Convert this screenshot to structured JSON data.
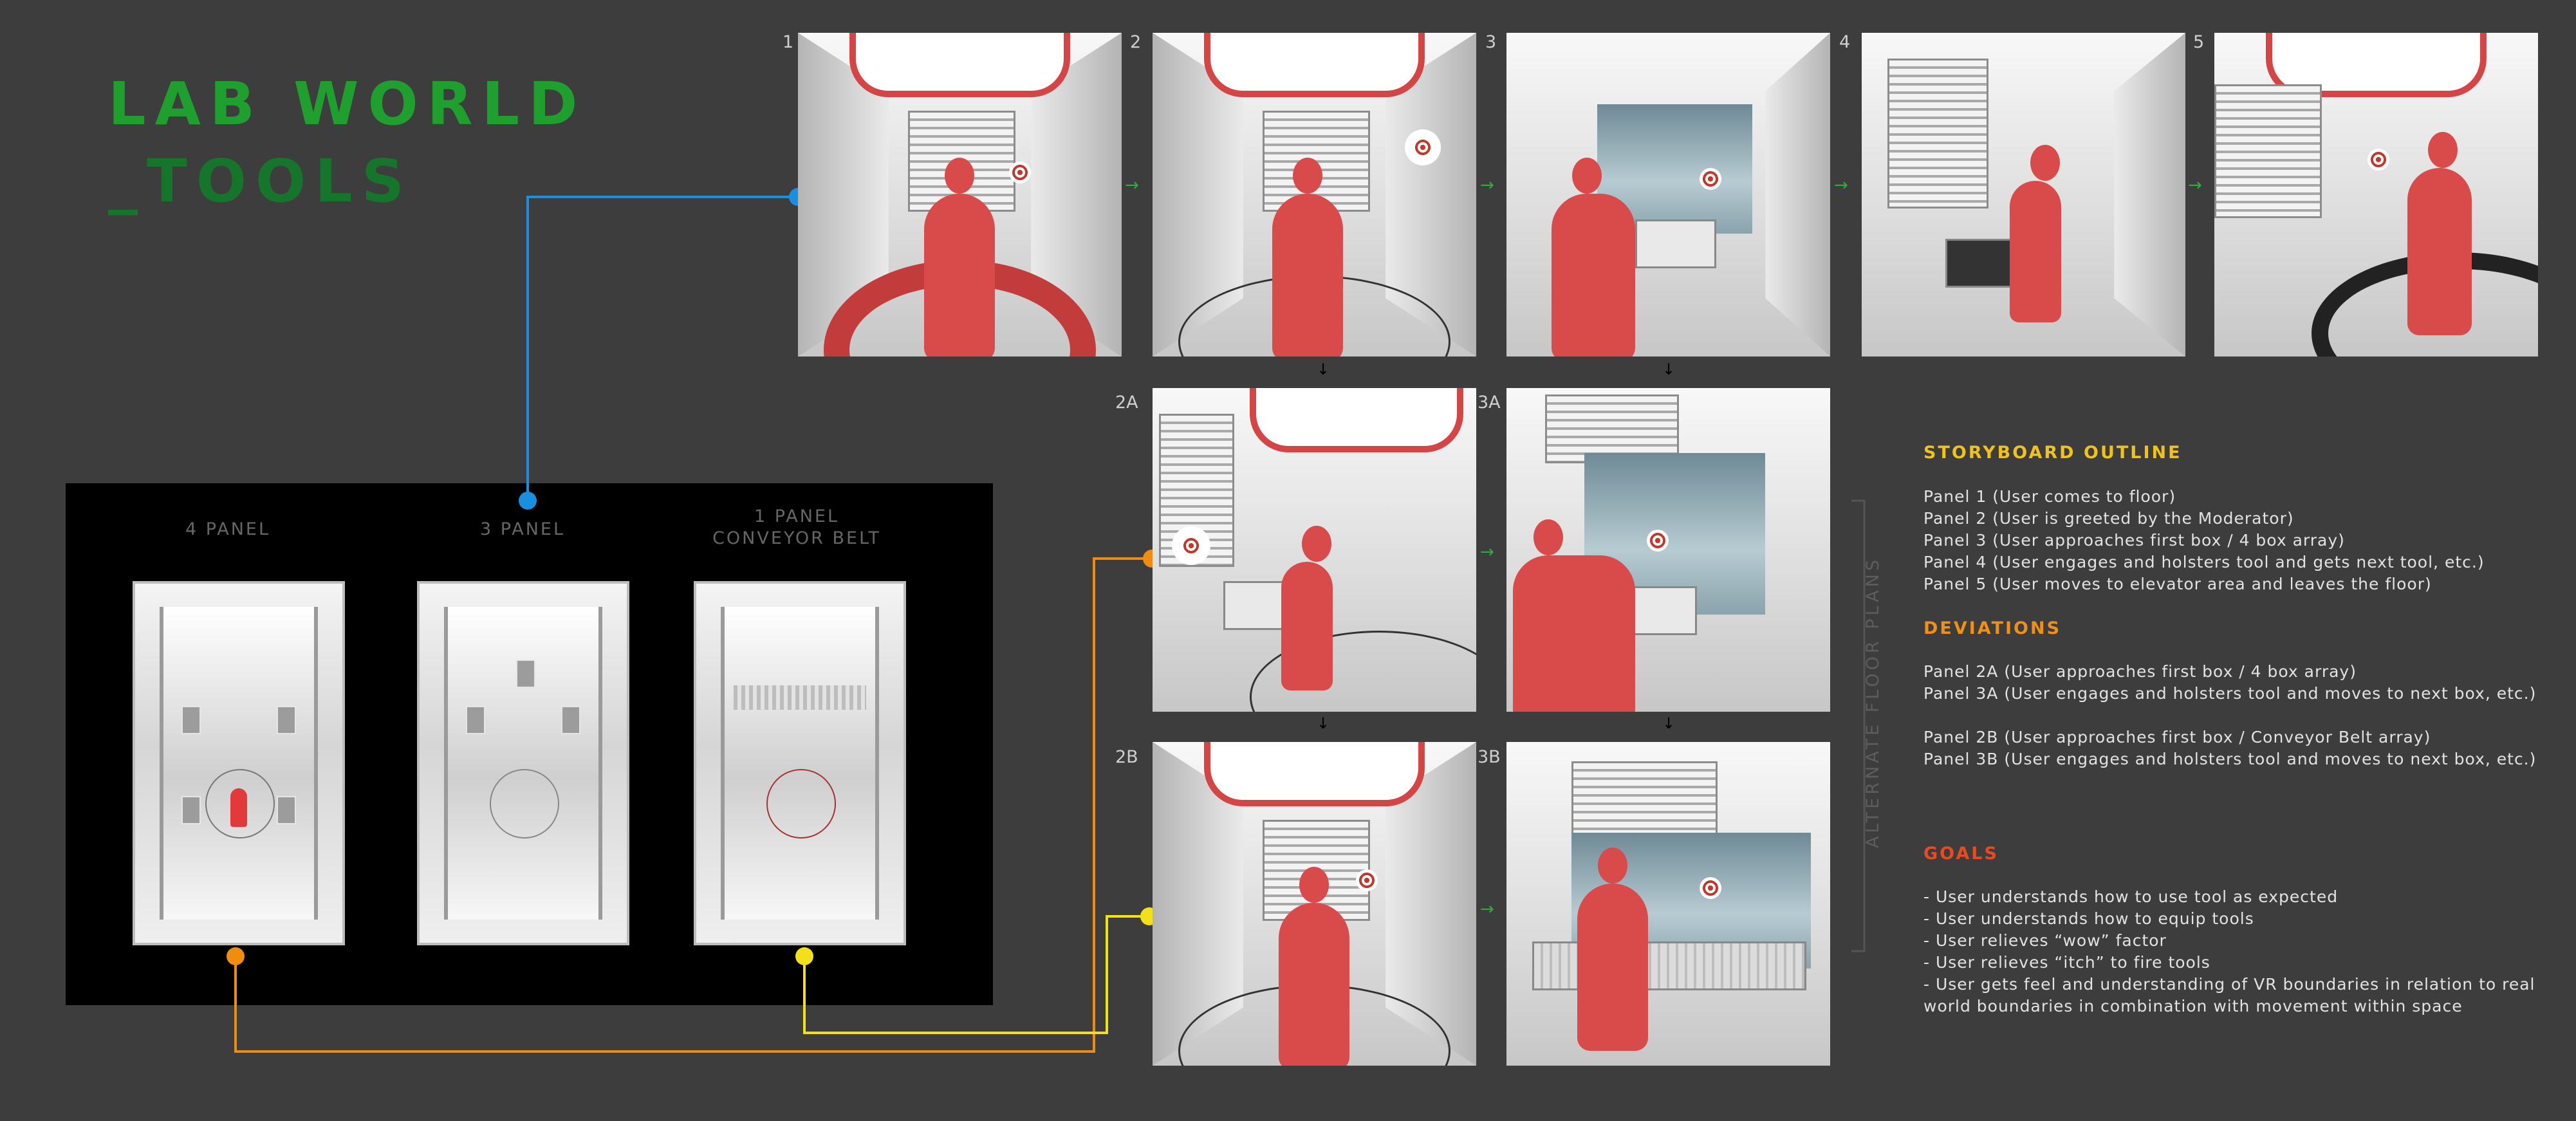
{
  "title": {
    "line1": "LAB WORLD",
    "line2": "_TOOLS"
  },
  "floor_plans": {
    "labels": [
      "4 PANEL",
      "3 PANEL",
      "1 PANEL",
      "CONVEYOR BELT"
    ]
  },
  "panels": {
    "p1": "1",
    "p2": "2",
    "p3": "3",
    "p4": "4",
    "p5": "5",
    "p2a": "2A",
    "p3a": "3A",
    "p2b": "2B",
    "p3b": "3B"
  },
  "alternate_label": "ALTERNATE FLOOR PLANS",
  "outline": {
    "storyboard_heading": "STORYBOARD OUTLINE",
    "storyboard_lines": [
      "Panel 1 (User comes to floor)",
      "Panel 2 (User is greeted by the Moderator)",
      "Panel 3 (User approaches first box / 4 box array)",
      "Panel 4 (User engages and holsters tool and gets next tool, etc.)",
      "Panel 5 (User moves to elevator area and leaves the floor)"
    ],
    "deviations_heading": "DEVIATIONS",
    "deviations_lines": [
      "Panel 2A (User approaches first box / 4 box array)",
      "Panel 3A (User engages and holsters tool and moves to next box, etc.)",
      "Panel 2B (User approaches first box / Conveyor Belt array)",
      "Panel 3B (User engages and holsters tool and moves to next box, etc.)"
    ],
    "goals_heading": "GOALS",
    "goals_lines": [
      "- User understands how to use tool as expected",
      "- User understands how to equip tools",
      "- User relieves “wow” factor",
      "- User relieves “itch” to fire tools",
      "- User gets feel and understanding of VR boundaries in relation to real",
      "world boundaries in combination with movement within space"
    ]
  },
  "colors": {
    "background": "#3d3d3d",
    "title_green": "#1fa02e",
    "storyboard_yellow": "#f0c21a",
    "deviations_orange": "#f09018",
    "goals_red": "#e84b24",
    "connector_blue": "#1a8fe0",
    "connector_orange": "#f08c10",
    "connector_yellow": "#f2e11a"
  }
}
